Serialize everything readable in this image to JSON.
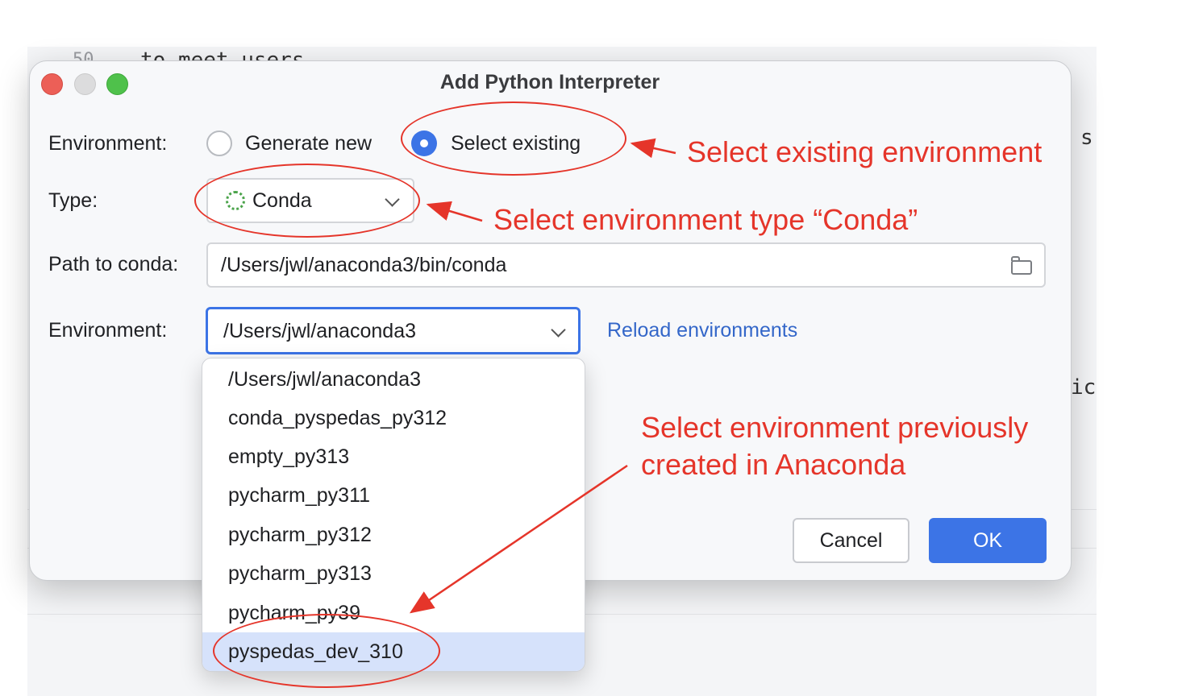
{
  "background_editor": {
    "line_number": "50",
    "code_fragment": "to meet users",
    "right_fragment_1": "s",
    "right_fragment_2": "ic"
  },
  "dialog": {
    "title": "Add Python Interpreter",
    "environment_label": "Environment:",
    "radio_generate_new": "Generate new",
    "radio_select_existing": "Select existing",
    "selected_mode": "Select existing",
    "type_label": "Type:",
    "type_value": "Conda",
    "path_label": "Path to conda:",
    "path_value": "/Users/jwl/anaconda3/bin/conda",
    "env_label": "Environment:",
    "env_value": "/Users/jwl/anaconda3",
    "reload_link": "Reload environments",
    "cancel_button": "Cancel",
    "ok_button": "OK"
  },
  "dropdown": {
    "items": [
      "/Users/jwl/anaconda3",
      "conda_pyspedas_py312",
      "empty_py313",
      "pycharm_py311",
      "pycharm_py312",
      "pycharm_py313",
      "pycharm_py39",
      "pyspedas_dev_310"
    ],
    "highlighted": "pyspedas_dev_310"
  },
  "annotations": {
    "select_existing": "Select existing environment",
    "select_type": "Select environment type “Conda”",
    "select_env_line1": "Select environment previously",
    "select_env_line2": "created in Anaconda",
    "color": "#e5352a"
  },
  "colors": {
    "accent": "#3c74e6",
    "link": "#3467c9",
    "highlight": "#d6e2fb"
  }
}
